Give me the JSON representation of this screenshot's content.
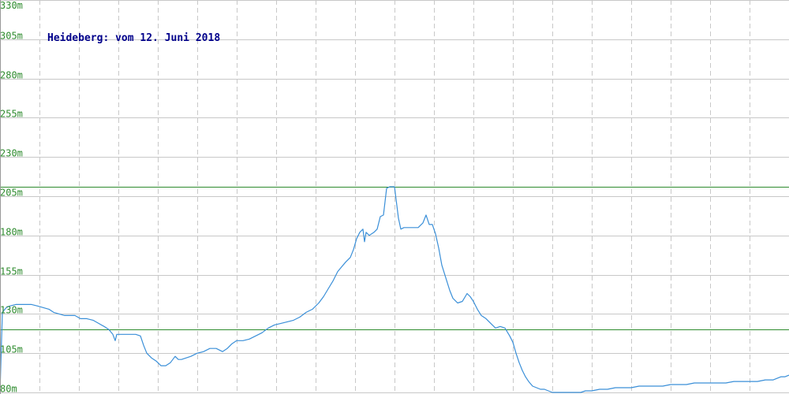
{
  "chart_data": {
    "type": "line",
    "title": "Heideberg: vom 12. Juni 2018",
    "xlabel": "",
    "ylabel": "",
    "ylim": [
      80,
      330
    ],
    "y_ticks": [
      80,
      105,
      130,
      155,
      180,
      205,
      230,
      255,
      280,
      305,
      330
    ],
    "y_tick_labels": [
      "80m",
      "105m",
      "130m",
      "155m",
      "180m",
      "205m",
      "230m",
      "255m",
      "280m",
      "305m",
      "330m"
    ],
    "xlim": [
      0,
      1000
    ],
    "grid": true,
    "reference_lines": [
      211,
      120
    ],
    "series": [
      {
        "color": "#3a8fd8",
        "x": [
          0,
          3,
          8,
          12,
          20,
          30,
          40,
          48,
          55,
          62,
          68,
          75,
          82,
          88,
          95,
          102,
          110,
          118,
          125,
          132,
          138,
          143,
          146,
          148,
          150,
          158,
          165,
          172,
          178,
          182,
          186,
          192,
          198,
          204,
          210,
          216,
          222,
          226,
          230,
          236,
          242,
          250,
          258,
          266,
          274,
          282,
          288,
          294,
          300,
          308,
          316,
          324,
          332,
          340,
          348,
          356,
          364,
          372,
          380,
          388,
          396,
          404,
          410,
          416,
          422,
          428,
          433,
          438,
          444,
          448,
          452,
          456,
          460,
          462,
          464,
          468,
          474,
          478,
          482,
          486,
          490,
          494,
          500,
          505,
          508,
          512,
          516,
          520,
          525,
          530,
          536,
          540,
          544,
          548,
          552,
          556,
          560,
          565,
          570,
          574,
          580,
          586,
          592,
          596,
          600,
          605,
          610,
          616,
          622,
          628,
          634,
          640,
          646,
          650,
          654,
          658,
          662,
          666,
          670,
          675,
          680,
          685,
          690,
          695,
          700,
          706,
          712,
          718,
          724,
          730,
          736,
          742,
          746,
          750,
          760,
          770,
          780,
          790,
          800,
          810,
          820,
          830,
          840,
          850,
          860,
          870,
          880,
          890,
          900,
          910,
          920,
          930,
          940,
          950,
          960,
          970,
          980,
          985,
          990,
          995,
          1000
        ],
        "values": [
          80,
          131,
          134,
          135,
          136,
          136,
          136,
          135,
          134,
          133,
          131,
          130,
          129,
          129,
          129,
          127,
          127,
          126,
          124,
          122,
          120,
          117,
          113,
          117,
          117,
          117,
          117,
          117,
          116,
          110,
          105,
          102,
          100,
          97,
          97,
          99,
          103,
          101,
          101,
          102,
          103,
          105,
          106,
          108,
          108,
          106,
          108,
          111,
          113,
          113,
          114,
          116,
          118,
          121,
          123,
          124,
          125,
          126,
          128,
          131,
          133,
          137,
          141,
          146,
          151,
          157,
          160,
          163,
          166,
          171,
          178,
          182,
          184,
          176,
          182,
          180,
          182,
          184,
          192,
          193,
          210,
          211,
          211,
          191,
          184,
          185,
          185,
          185,
          185,
          185,
          188,
          193,
          187,
          187,
          181,
          172,
          161,
          153,
          145,
          140,
          137,
          138,
          143,
          141,
          138,
          133,
          129,
          127,
          124,
          121,
          122,
          121,
          116,
          112,
          105,
          99,
          94,
          90,
          87,
          84,
          83,
          82,
          82,
          81,
          80,
          80,
          80,
          80,
          80,
          80,
          80,
          81,
          81,
          81,
          82,
          82,
          83,
          83,
          83,
          84,
          84,
          84,
          84,
          85,
          85,
          85,
          86,
          86,
          86,
          86,
          86,
          87,
          87,
          87,
          87,
          88,
          88,
          89,
          90,
          90,
          91
        ]
      }
    ]
  }
}
